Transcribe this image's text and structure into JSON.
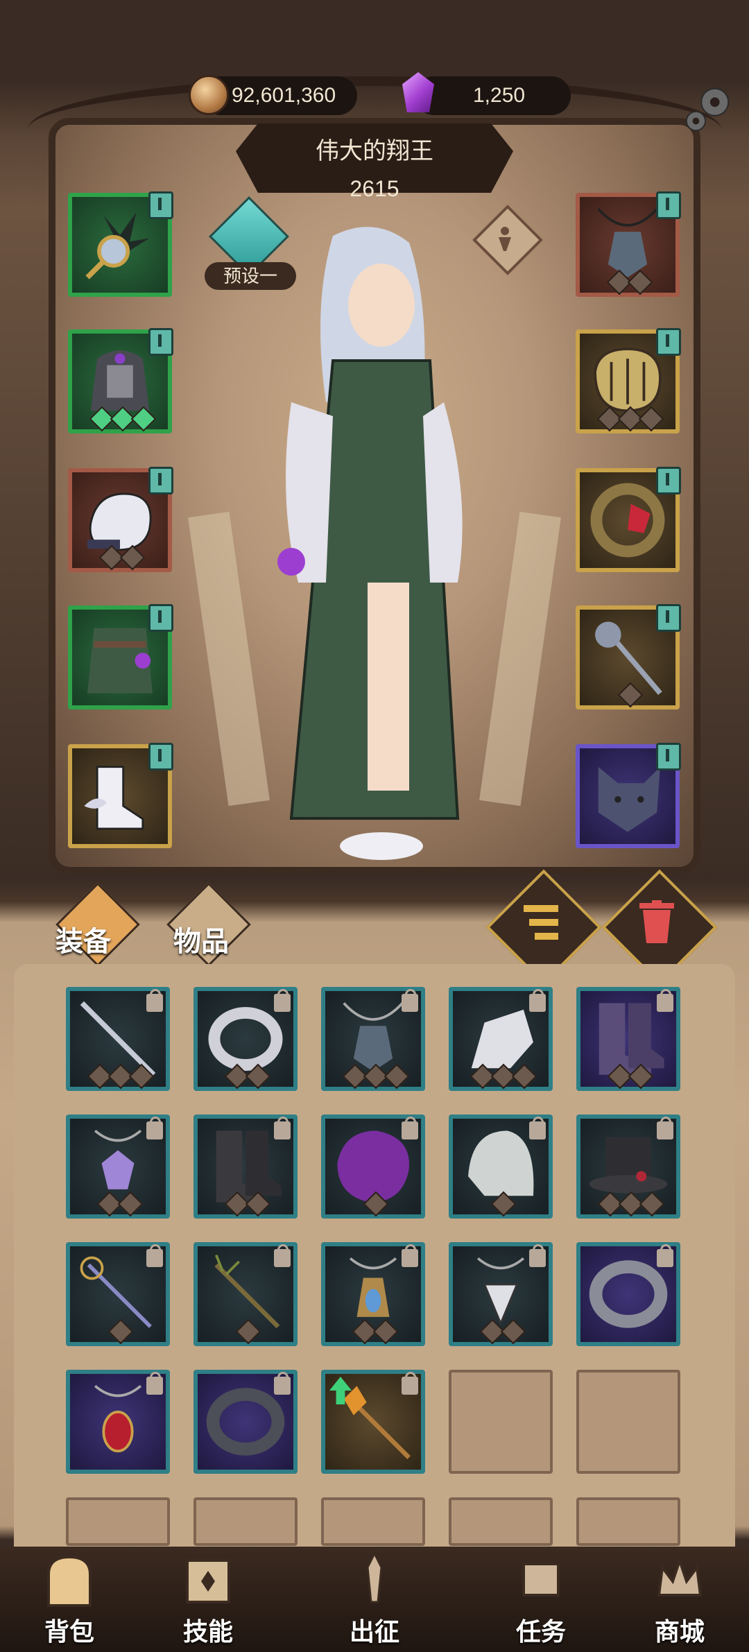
{
  "currency": {
    "gold_value": "92,601,360",
    "gem_value": "1,250",
    "gold_icon": "coin-icon",
    "gem_icon": "crystal-icon"
  },
  "hero": {
    "title": "伟大的翔王",
    "power": "2615",
    "preset_label": "预设一"
  },
  "tabs": {
    "equipment": "装备",
    "items": "物品"
  },
  "nav": {
    "bag": "背包",
    "skills": "技能",
    "battle": "出征",
    "quests": "任务",
    "shop": "商城"
  },
  "colors": {
    "teal_border": "#2f7f86",
    "gold_border": "#c9a24a",
    "purple_border": "#6a55c8",
    "green_border": "#2fa24a",
    "red_border": "#a35a46",
    "accent_teal": "#5fb8a8"
  }
}
